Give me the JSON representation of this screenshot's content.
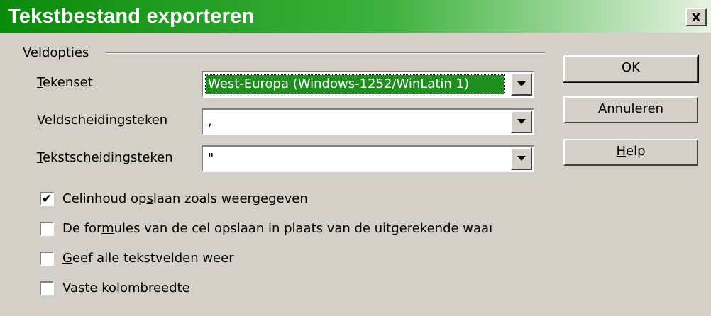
{
  "window": {
    "title": "Tekstbestand exporteren",
    "close_glyph": "x",
    "titlebar_colors": [
      "#0a8a0a",
      "#3fb23f",
      "#e6f3e2"
    ]
  },
  "group": {
    "label": "Veldopties"
  },
  "fields": {
    "charset": {
      "label_mnemonic": "T",
      "label_rest": "ekenset",
      "value": "West-Europa (Windows-1252/WinLatin 1)",
      "selected": true
    },
    "field_separator": {
      "label_mnemonic": "V",
      "label_rest": "eldscheidingsteken",
      "value": ","
    },
    "text_separator": {
      "label_mnemonic": "T",
      "label_rest": "ekstscheidingsteken",
      "value": "\""
    }
  },
  "checkboxes": [
    {
      "pre": "Celinhoud op",
      "mnemonic": "s",
      "post": "laan zoals weergegeven",
      "checked": true
    },
    {
      "pre": "De for",
      "mnemonic": "m",
      "post": "ules van de cel opslaan in plaats van de uitgerekende waaı",
      "checked": false
    },
    {
      "pre": "",
      "mnemonic": "G",
      "post": "eef alle tekstvelden weer",
      "checked": false
    },
    {
      "pre": "Vaste ",
      "mnemonic": "k",
      "post": "olombreedte",
      "checked": false
    }
  ],
  "buttons": {
    "ok": "OK",
    "cancel": "Annuleren",
    "help_mnemonic": "H",
    "help_rest": "elp"
  },
  "check_glyph": "✔",
  "colors": {
    "dialog_bg": "#d4d0c8",
    "selection_bg": "#1e8f1e"
  }
}
